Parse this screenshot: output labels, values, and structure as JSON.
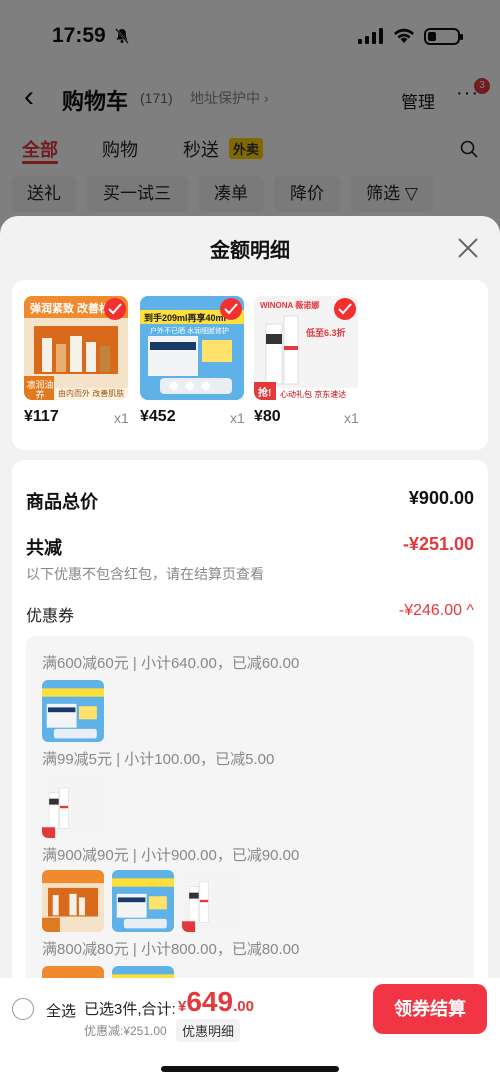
{
  "status_bar": {
    "time": "17:59"
  },
  "nav": {
    "back": "‹",
    "title": "购物车",
    "count": "(171)",
    "address": "地址保护中 ›",
    "manage": "管理",
    "more": "···",
    "badge": "3"
  },
  "tabs": [
    {
      "label": "全部",
      "active": true
    },
    {
      "label": "购物",
      "active": false
    },
    {
      "label": "秒送",
      "active": false
    }
  ],
  "tab_tag": "外卖",
  "chips": [
    "送礼",
    "买一试三",
    "凑单",
    "降价",
    "筛选 ▽"
  ],
  "sheet": {
    "title": "金额明细",
    "products": [
      {
        "price": "¥117",
        "qty": "x1",
        "img_lines": [
          "弹润紧致 改善松弛",
          "由内而外 改善肌肤",
          "凛润油养"
        ]
      },
      {
        "price": "¥452",
        "qty": "x1",
        "img_lines": [
          "到手209ml再享40ml",
          "户外不已晒 水润细腻修护"
        ]
      },
      {
        "price": "¥80",
        "qty": "x1",
        "img_lines": [
          "WINONA 薇诺娜",
          "低至6.3折",
          "心动礼包 京东速达",
          "抢!"
        ]
      }
    ],
    "total_label": "商品总价",
    "total_value": "¥900.00",
    "minus_label": "共减",
    "minus_value": "-¥251.00",
    "note": "以下优惠不包含红包，请在结算页查看",
    "coupon_label": "优惠券",
    "coupon_value": "-¥246.00 ^",
    "coupon_groups": [
      {
        "text": "满600减60元 | 小计640.00，已减60.00",
        "thumbs": [
          "p2"
        ]
      },
      {
        "text": "满99减5元 | 小计100.00，已减5.00",
        "thumbs": [
          "p3"
        ]
      },
      {
        "text": "满900减90元 | 小计900.00，已减90.00",
        "thumbs": [
          "p1",
          "p2",
          "p3"
        ]
      },
      {
        "text": "满800减80元 | 小计800.00，已减80.00",
        "thumbs": [
          "p1",
          "p2"
        ]
      }
    ]
  },
  "bottom_bar": {
    "select_all": "全选",
    "selected_text": "已选3件,合计:",
    "currency": "¥",
    "total_big": "649",
    "total_dec": ".00",
    "discount": "优惠减:¥251.00",
    "detail_link": "优惠明细",
    "checkout": "领券结算"
  },
  "colors": {
    "accent": "#e4393c",
    "checkout": "#f23545",
    "tag": "#ffd200"
  }
}
